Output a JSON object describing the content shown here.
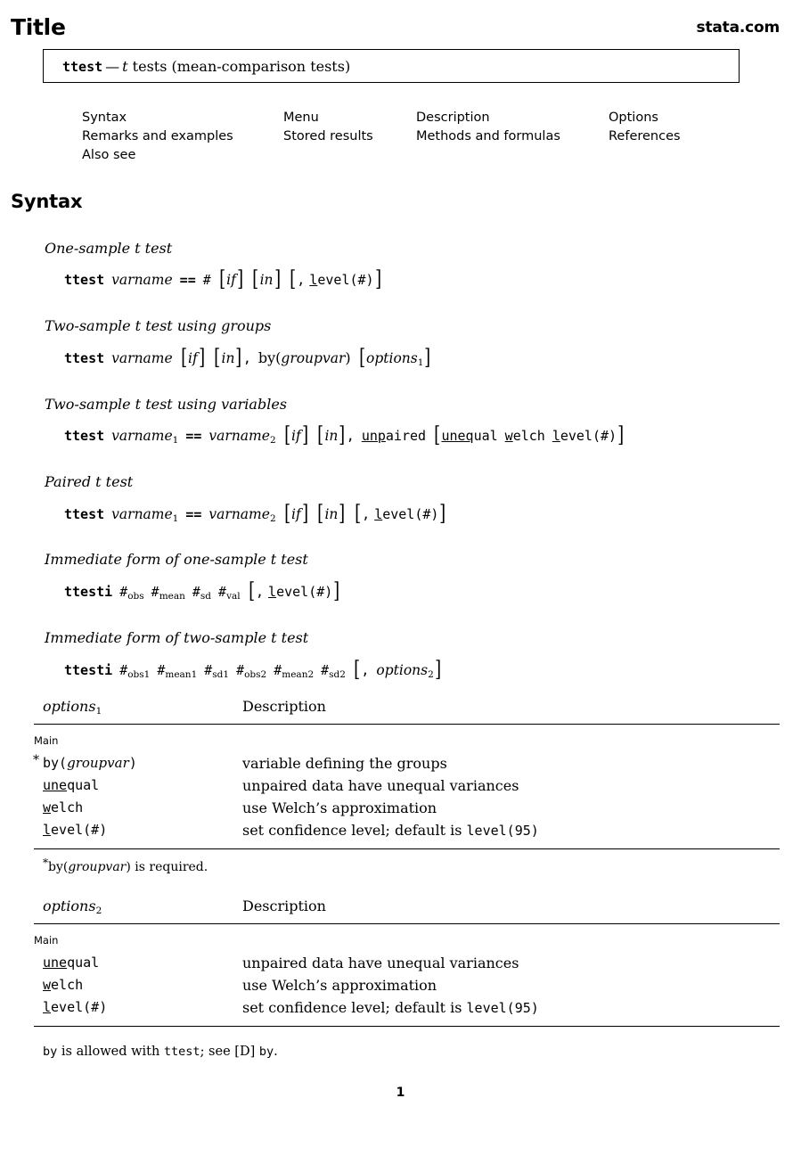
{
  "header": {
    "title": "Title",
    "site": "stata.com"
  },
  "title_box": {
    "command": "ttest",
    "dash": "—",
    "description_italic": "t",
    "description_rest": " tests (mean-comparison tests)"
  },
  "nav": {
    "columns": [
      {
        "items": [
          "Syntax",
          "Remarks and examples",
          "Also see"
        ]
      },
      {
        "items": [
          "Menu",
          "Stored results"
        ]
      },
      {
        "items": [
          "Description",
          "Methods and formulas"
        ]
      },
      {
        "items": [
          "Options",
          "References"
        ]
      }
    ]
  },
  "sections": {
    "syntax_heading": "Syntax"
  },
  "syntax": {
    "blocks": [
      {
        "label": "One-sample t test",
        "command": "ttest",
        "parts": "varname == # [if] [in] [, level(#)]"
      },
      {
        "label": "Two-sample t test using groups",
        "command": "ttest",
        "parts": "varname [if] [in], by(groupvar) [options1]"
      },
      {
        "label": "Two-sample t test using variables",
        "command": "ttest",
        "parts": "varname1 == varname2 [if] [in], unpaired [unequal welch level(#)]"
      },
      {
        "label": "Paired t test",
        "command": "ttest",
        "parts": "varname1 == varname2 [if] [in] [, level(#)]"
      },
      {
        "label": "Immediate form of one-sample t test",
        "command": "ttesti",
        "parts": "#obs #mean #sd #val [, level(#)]"
      },
      {
        "label": "Immediate form of two-sample t test",
        "command": "ttesti",
        "parts": "#obs1 #mean1 #sd1 #obs2 #mean2 #sd2 [, options2]"
      }
    ],
    "tokens": {
      "ttest": "ttest",
      "ttesti": "ttesti",
      "varname": "varname",
      "eqeq": "==",
      "hash": "#",
      "if": "if",
      "in": "in",
      "comma": ",",
      "level": "evel(#)",
      "level_abbrev": "l",
      "by": "by(",
      "groupvar": "groupvar",
      "close_paren": ")",
      "options1": "options",
      "options2": "options",
      "unpaired_abbrev": "unp",
      "unpaired_rest": "aired",
      "unequal_abbrev": "uneq",
      "unequal_rest": "ual",
      "welch_abbrev": "w",
      "welch_rest": "elch",
      "sub_obs": "obs",
      "sub_mean": "mean",
      "sub_sd": "sd",
      "sub_val": "val",
      "sub_obs1": "obs1",
      "sub_mean1": "mean1",
      "sub_sd1": "sd1",
      "sub_obs2": "obs2",
      "sub_mean2": "mean2",
      "sub_sd2": "sd2",
      "sub_1": "1",
      "sub_2": "2",
      "bracket_open": "[",
      "bracket_close": "]"
    }
  },
  "options_table_1": {
    "header_left": "options",
    "header_left_sub": "1",
    "header_right": "Description",
    "group_label": "Main",
    "rows": [
      {
        "name_star": "*",
        "name_abbrev": "",
        "name_mono": "by(",
        "name_var": "groupvar",
        "name_tail": ")",
        "description": "variable defining the groups"
      },
      {
        "name_star": "",
        "name_abbrev": "une",
        "name_mono": "qual",
        "name_var": "",
        "name_tail": "",
        "description": "unpaired data have unequal variances"
      },
      {
        "name_star": "",
        "name_abbrev": "w",
        "name_mono": "elch",
        "name_var": "",
        "name_tail": "",
        "description": "use Welch’s approximation"
      },
      {
        "name_star": "",
        "name_abbrev": "l",
        "name_mono": "evel(#)",
        "name_var": "",
        "name_tail": "",
        "description_pre": "set confidence level; default is ",
        "description_mono": "level(95)",
        "description": ""
      }
    ],
    "note_star": "*",
    "note_pre": "by(",
    "note_var": "groupvar",
    "note_post": ") is required."
  },
  "options_table_2": {
    "header_left": "options",
    "header_left_sub": "2",
    "header_right": "Description",
    "group_label": "Main",
    "rows": [
      {
        "name_abbrev": "une",
        "name_mono": "qual",
        "description": "unpaired data have unequal variances"
      },
      {
        "name_abbrev": "w",
        "name_mono": "elch",
        "description": "use Welch’s approximation"
      },
      {
        "name_abbrev": "l",
        "name_mono": "evel(#)",
        "description_pre": "set confidence level; default is ",
        "description_mono": "level(95)",
        "description": ""
      }
    ]
  },
  "footer": {
    "by_note_mono_1": "by",
    "by_note_rm_1": " is allowed with ",
    "by_note_mono_2": "ttest",
    "by_note_rm_2": "; see ",
    "by_note_rm_3": "[D] ",
    "by_note_mono_3": "by",
    "by_note_rm_4": ".",
    "page_number": "1"
  }
}
